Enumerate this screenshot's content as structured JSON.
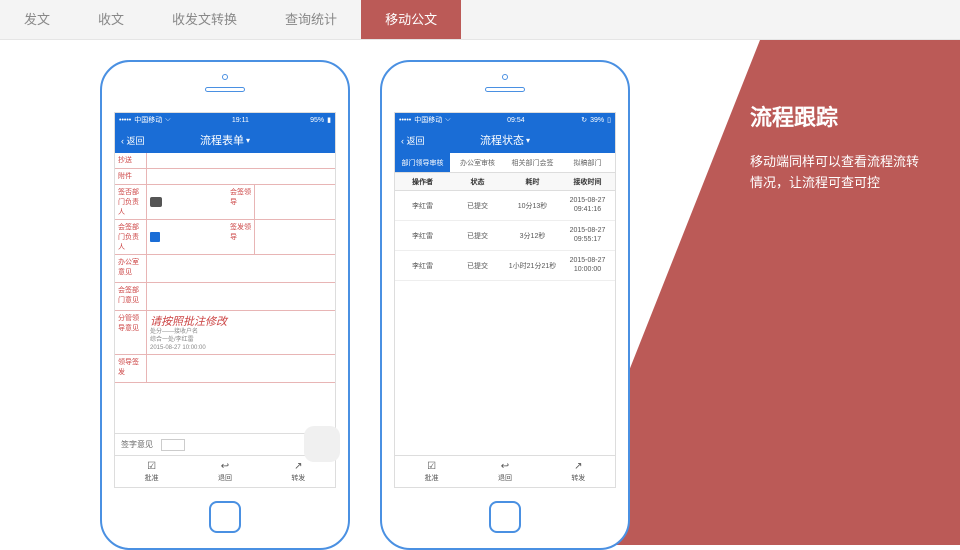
{
  "tabs": [
    "发文",
    "收文",
    "收发文转换",
    "查询统计",
    "移动公文"
  ],
  "activeTab": 4,
  "panel": {
    "title": "流程跟踪",
    "desc": "移动端同样可以查看流程流转情况，让流程可查可控"
  },
  "phone1": {
    "status": {
      "carrier": "中国移动",
      "time": "19:11",
      "battery": "95%"
    },
    "nav": {
      "back": "返回",
      "title": "流程表单"
    },
    "rows": {
      "r1": "抄送",
      "r2": "附件",
      "r3a": "签否部门负责人",
      "r3b": "会签领导",
      "r4a": "会签部门负责人",
      "r4b": "签发领导",
      "r5": "办公室意见",
      "r6": "会签部门意见",
      "r7": "分管领导意见",
      "r7_hand": "请按照批注修改",
      "r7_meta1": "处分——接收户名",
      "r7_meta2": "综合一处/李红雷",
      "r7_meta3": "2015-08-27 10:00:00",
      "r8": "领导签发"
    },
    "sign": "签字意见",
    "bottom": [
      "批准",
      "退回",
      "转发"
    ]
  },
  "phone2": {
    "status": {
      "carrier": "中国移动",
      "time": "09:54",
      "battery": "39%"
    },
    "nav": {
      "back": "返回",
      "title": "流程状态"
    },
    "tabs": [
      "部门领导审核",
      "办公室审核",
      "相关部门会签",
      "拟稿部门"
    ],
    "columns": [
      "操作者",
      "状态",
      "耗时",
      "接收时间"
    ],
    "data": [
      {
        "op": "李红雷",
        "st": "已提交",
        "dur": "10分13秒",
        "t1": "2015-08-27",
        "t2": "09:41:16"
      },
      {
        "op": "李红雷",
        "st": "已提交",
        "dur": "3分12秒",
        "t1": "2015-08-27",
        "t2": "09:55:17"
      },
      {
        "op": "李红雷",
        "st": "已提交",
        "dur": "1小时21分21秒",
        "t1": "2015-08-27",
        "t2": "10:00:00"
      }
    ],
    "bottom": [
      "批准",
      "退回",
      "转发"
    ]
  }
}
